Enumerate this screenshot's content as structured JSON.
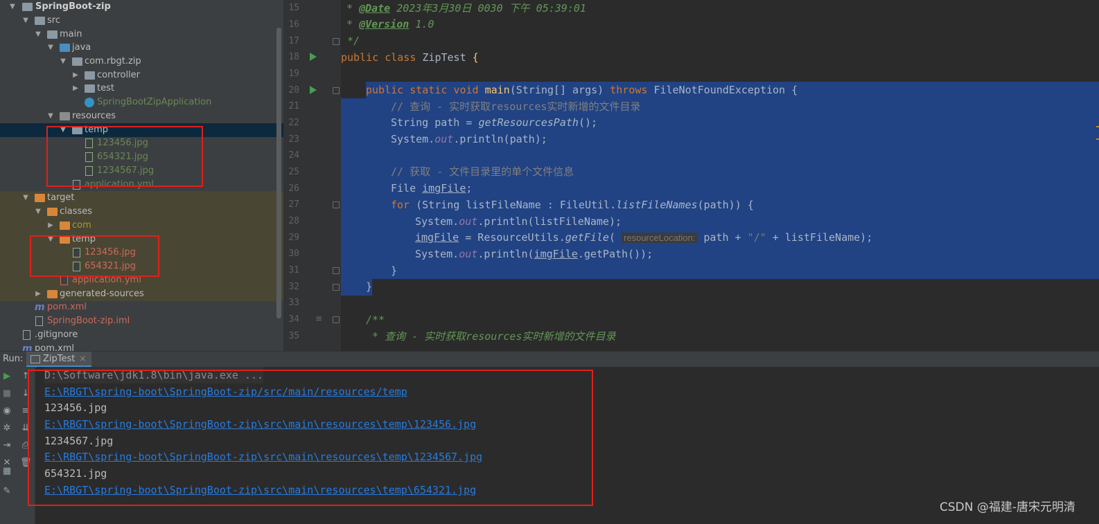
{
  "tree": {
    "items": [
      {
        "label": "SpringBoot-zip"
      },
      {
        "label": "src"
      },
      {
        "label": "main"
      },
      {
        "label": "java"
      },
      {
        "label": "com.rbgt.zip"
      },
      {
        "label": "controller"
      },
      {
        "label": "test"
      },
      {
        "label": "SpringBootZipApplication"
      },
      {
        "label": "resources"
      },
      {
        "label": "temp"
      },
      {
        "label": "123456.jpg"
      },
      {
        "label": "654321.jpg"
      },
      {
        "label": "1234567.jpg"
      },
      {
        "label": "application.yml"
      },
      {
        "label": "target"
      },
      {
        "label": "classes"
      },
      {
        "label": "com"
      },
      {
        "label": "temp"
      },
      {
        "label": "123456.jpg"
      },
      {
        "label": "654321.jpg"
      },
      {
        "label": "application.yml"
      },
      {
        "label": "generated-sources"
      },
      {
        "label": "pom.xml"
      },
      {
        "label": "SpringBoot-zip.iml"
      },
      {
        "label": ".gitignore"
      },
      {
        "label": "pom.xml"
      }
    ]
  },
  "editor": {
    "line_numbers": [
      "15",
      "16",
      "17",
      "18",
      "19",
      "20",
      "21",
      "22",
      "23",
      "24",
      "25",
      "26",
      "27",
      "28",
      "29",
      "30",
      "31",
      "32",
      "33",
      "34",
      "35"
    ],
    "code": {
      "l15_tag": "@Date",
      "l15_text": " 2023年3月30日 0030 下午 05:39:01",
      "l16_tag": "@Version",
      "l16_text": " 1.0",
      "l17": " */",
      "l18_kw": "public class ",
      "l18_name": "ZipTest ",
      "l18_brace": "{",
      "l20_kw1": "public static void ",
      "l20_fn": "main",
      "l20_args": "(String[] args) ",
      "l20_kw2": "throws ",
      "l20_exc": "FileNotFoundException {",
      "l21": "// 查询 - 实时获取resources实时新增的文件目录",
      "l22_a": "String path = ",
      "l22_b": "getResourcesPath",
      "l22_c": "();",
      "l23_a": "System.",
      "l23_b": "out",
      "l23_c": ".println(path);",
      "l25": "// 获取 - 文件目录里的单个文件信息",
      "l26_a": "File ",
      "l26_b": "imgFile",
      "l26_c": ";",
      "l27_kw": "for ",
      "l27_a": "(String listFileName : FileUtil.",
      "l27_b": "listFileNames",
      "l27_c": "(path)) {",
      "l28_a": "System.",
      "l28_b": "out",
      "l28_c": ".println(listFileName);",
      "l29_a": "imgFile",
      "l29_b": " = ResourceUtils.",
      "l29_c": "getFile",
      "l29_d": "( ",
      "l29_hint": "resourceLocation:",
      "l29_e": " path + ",
      "l29_str": "\"/\"",
      "l29_f": " + listFileName);",
      "l30_a": "System.",
      "l30_b": "out",
      "l30_c": ".println(",
      "l30_d": "imgFile",
      "l30_e": ".getPath());",
      "l31": "}",
      "l32": "}",
      "l34": "/**",
      "l35": " * 查询 - 实时获取resources实时新增的文件目录"
    }
  },
  "run": {
    "label": "Run:",
    "tab": "ZipTest",
    "close": "×",
    "lines": [
      "D:\\Software\\jdk1.8\\bin\\java.exe ...",
      "E:\\RBGT\\spring-boot\\SpringBoot-zip/src/main/resources/temp",
      "123456.jpg",
      "E:\\RBGT\\spring-boot\\SpringBoot-zip\\src\\main\\resources\\temp\\123456.jpg",
      "1234567.jpg",
      "E:\\RBGT\\spring-boot\\SpringBoot-zip\\src\\main\\resources\\temp\\1234567.jpg",
      "654321.jpg",
      "E:\\RBGT\\spring-boot\\SpringBoot-zip\\src\\main\\resources\\temp\\654321.jpg"
    ]
  },
  "watermark": "CSDN @福建-唐宋元明清",
  "colors": {
    "accent_selection": "#214283",
    "annotation_box": "#e0201a",
    "link": "#287bde"
  }
}
